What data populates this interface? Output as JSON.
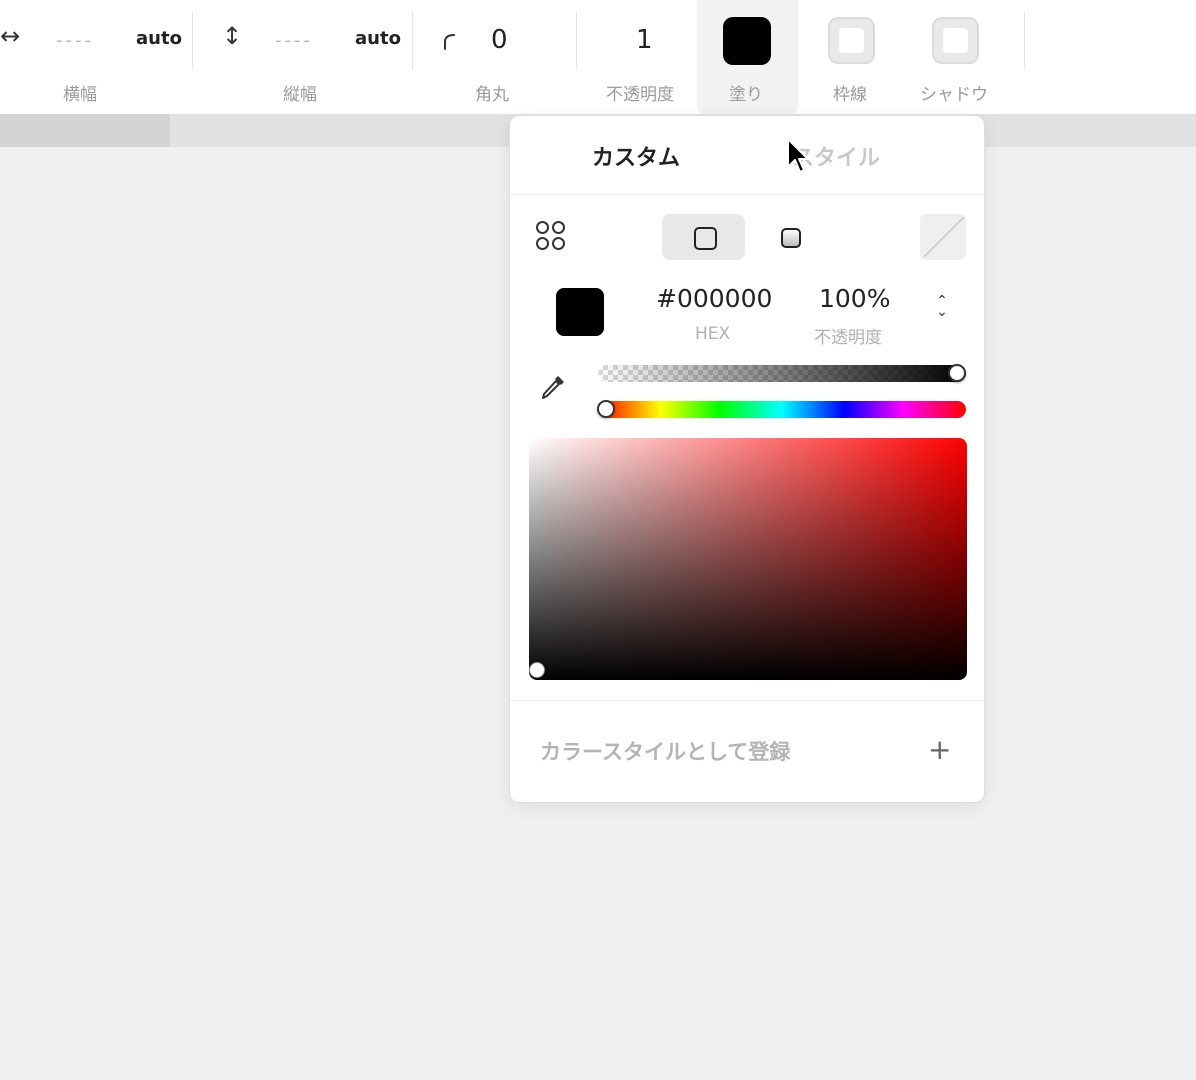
{
  "toolbar": {
    "width": {
      "icon": "horizontal-arrows-icon",
      "glyph": "↔",
      "placeholder": "----",
      "value": "auto",
      "label": "横幅"
    },
    "height": {
      "icon": "vertical-arrows-icon",
      "glyph": "↕",
      "placeholder": "----",
      "value": "auto",
      "label": "縦幅"
    },
    "radius": {
      "icon": "corner-radius-icon",
      "value": "0",
      "label": "角丸"
    },
    "opacity": {
      "value": "1",
      "label": "不透明度"
    },
    "fill": {
      "label": "塗り",
      "color": "#000000"
    },
    "stroke": {
      "label": "枠線"
    },
    "shadow": {
      "label": "シャドウ"
    }
  },
  "popover": {
    "tabs": [
      {
        "label": "カスタム",
        "active": true
      },
      {
        "label": "スタイル",
        "active": false
      }
    ],
    "modes": [
      "palette-grid-icon",
      "solid-fill-icon",
      "gradient-fill-icon",
      "no-fill-icon"
    ],
    "color": {
      "swatch": "#000000",
      "hex": "#000000",
      "hex_label": "HEX",
      "opacity": "100%",
      "opacity_label": "不透明度"
    },
    "alpha_level": 1.0,
    "hue_level": 0.0,
    "register_label": "カラースタイルとして登録",
    "add_glyph": "+"
  }
}
